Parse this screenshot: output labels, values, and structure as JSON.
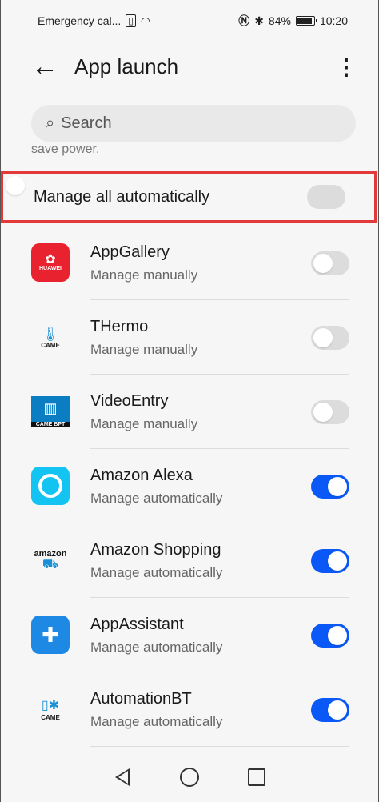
{
  "status_bar": {
    "left_text": "Emergency cal...",
    "battery": "84%",
    "time": "10:20"
  },
  "header": {
    "title": "App launch"
  },
  "search": {
    "placeholder": "Search"
  },
  "clipped_text": "save power.",
  "manage_all": {
    "label": "Manage all automatically",
    "enabled": false
  },
  "apps": [
    {
      "name": "AppGallery",
      "status": "Manage manually",
      "icon": "appgallery-icon",
      "enabled": false
    },
    {
      "name": "THermo",
      "status": "Manage manually",
      "icon": "thermo-icon",
      "enabled": false
    },
    {
      "name": "VideoEntry",
      "status": "Manage manually",
      "icon": "videoentry-icon",
      "enabled": false
    },
    {
      "name": "Amazon Alexa",
      "status": "Manage automatically",
      "icon": "alexa-icon",
      "enabled": true
    },
    {
      "name": "Amazon Shopping",
      "status": "Manage automatically",
      "icon": "amazon-shopping-icon",
      "enabled": true
    },
    {
      "name": "AppAssistant",
      "status": "Manage automatically",
      "icon": "appassistant-icon",
      "enabled": true
    },
    {
      "name": "AutomationBT",
      "status": "Manage automatically",
      "icon": "automationbt-icon",
      "enabled": true
    }
  ],
  "icon_labels": {
    "huawei": "HUAWEI",
    "came": "CAME",
    "came_bpt": "CAME BPT",
    "amazon": "amazon"
  },
  "colors": {
    "accent": "#0a59f7",
    "toggle_off": "#dcdcdc",
    "highlight": "#e23a3a"
  }
}
